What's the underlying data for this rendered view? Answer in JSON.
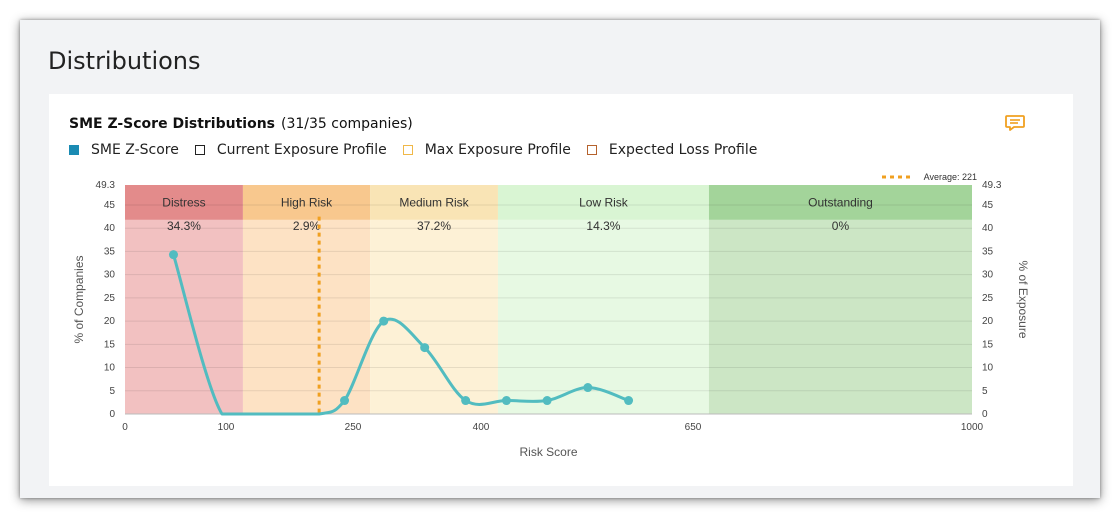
{
  "section": {
    "title": "Distributions"
  },
  "card": {
    "title": "SME Z-Score Distributions",
    "subtitle": "(31/35 companies)",
    "comment_icon": "comment-icon"
  },
  "legend": [
    {
      "label": "SME Z-Score",
      "color": "#1a8bb3",
      "filled": true
    },
    {
      "label": "Current Exposure Profile",
      "color": "#222222",
      "filled": false
    },
    {
      "label": "Max Exposure Profile",
      "color": "#f0b848",
      "filled": false
    },
    {
      "label": "Expected Loss Profile",
      "color": "#b5622d",
      "filled": false
    }
  ],
  "chart_data": {
    "type": "line",
    "xlabel": "Risk Score",
    "ylabel": "% of Companies",
    "y2label": "% of Exposure",
    "x_ticks": [
      "0",
      "100",
      "250",
      "400",
      "650",
      "1000"
    ],
    "y_ticks": [
      "0",
      "5",
      "10",
      "15",
      "20",
      "25",
      "30",
      "35",
      "40",
      "45",
      "49.3"
    ],
    "y2_ticks": [
      "0",
      "5",
      "10",
      "15",
      "20",
      "25",
      "30",
      "35",
      "40",
      "45",
      "49.3"
    ],
    "xlim": [
      0,
      1000
    ],
    "ylim": [
      0,
      49.3
    ],
    "grid": true,
    "average": {
      "label": "Average: 221",
      "value": 210,
      "color": "#f0a020"
    },
    "bands": [
      {
        "name": "Distress",
        "from": 0,
        "to": 120,
        "pct": "34.3%",
        "header_color": "#e38b8b",
        "bg_color": "#f2c1c1"
      },
      {
        "name": "High Risk",
        "from": 120,
        "to": 270,
        "pct": "2.9%",
        "header_color": "#f8c88e",
        "bg_color": "#fde2c4"
      },
      {
        "name": "Medium Risk",
        "from": 270,
        "to": 420,
        "pct": "37.2%",
        "header_color": "#f9e4b5",
        "bg_color": "#fdf1d6"
      },
      {
        "name": "Low Risk",
        "from": 420,
        "to": 670,
        "pct": "14.3%",
        "header_color": "#d9f5d3",
        "bg_color": "#e7f9e3"
      },
      {
        "name": "Outstanding",
        "from": 670,
        "to": 1000,
        "pct": "0%",
        "header_color": "#a3d49a",
        "bg_color": "#cce6c5"
      }
    ],
    "series": [
      {
        "name": "SME Z-Score",
        "color": "#52bcc0",
        "x": [
          48,
          96,
          150,
          210,
          240,
          286,
          334,
          382,
          430,
          478,
          526,
          574
        ],
        "y": [
          34.3,
          0,
          0,
          0,
          2.9,
          20.0,
          14.3,
          2.9,
          2.9,
          2.9,
          5.7,
          2.9
        ],
        "markers": [
          true,
          false,
          false,
          false,
          true,
          true,
          true,
          true,
          true,
          true,
          true,
          true
        ]
      }
    ]
  }
}
